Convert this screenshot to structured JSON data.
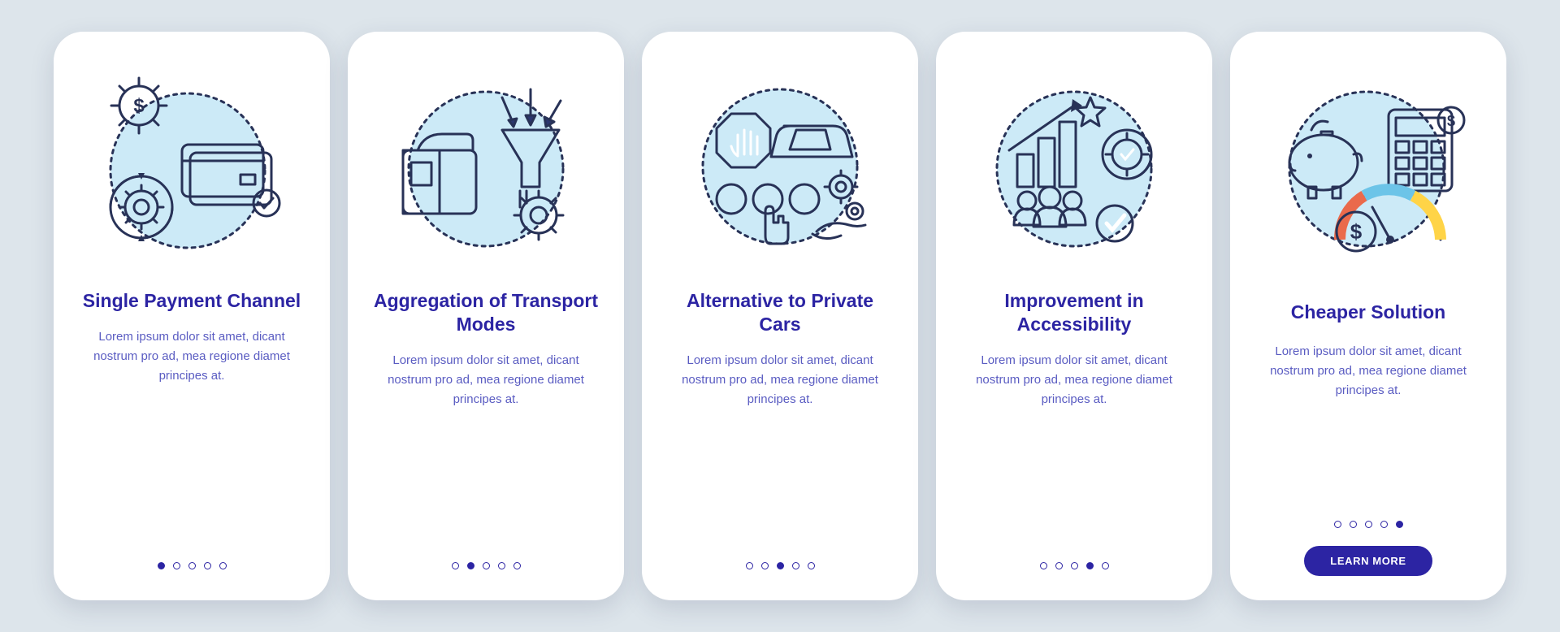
{
  "slides": [
    {
      "title": "Single Payment Channel",
      "body": "Lorem ipsum dolor sit amet, dicant nostrum pro ad, mea regione diamet principes at.",
      "button": null
    },
    {
      "title": "Aggregation of Transport Modes",
      "body": "Lorem ipsum dolor sit amet, dicant nostrum pro ad, mea regione diamet principes at.",
      "button": null
    },
    {
      "title": "Alternative to Private Cars",
      "body": "Lorem ipsum dolor sit amet, dicant nostrum pro ad, mea regione diamet principes at.",
      "button": null
    },
    {
      "title": "Improvement in Accessibility",
      "body": "Lorem ipsum dolor sit amet, dicant nostrum pro ad, mea regione diamet principes at.",
      "button": null
    },
    {
      "title": "Cheaper Solution",
      "body": "Lorem ipsum dolor sit amet, dicant nostrum pro ad, mea regione diamet principes at.",
      "button": "LEARN MORE"
    }
  ],
  "colors": {
    "background": "#dde5eb",
    "heading": "#2c24a3",
    "text": "#5a5cc2",
    "accentOrange": "#ea6a4b",
    "accentYellow": "#ffd447",
    "accentBlue": "#6cc4e8",
    "outline": "#283257"
  }
}
